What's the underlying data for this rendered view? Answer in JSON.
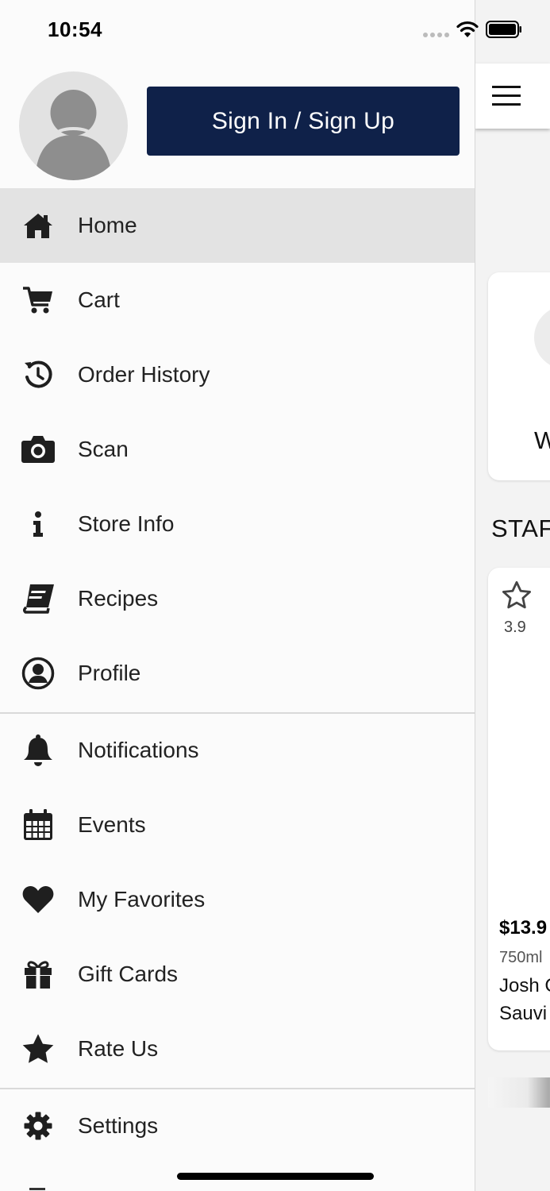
{
  "status_bar": {
    "time": "10:54"
  },
  "drawer": {
    "signin_label": "Sign In / Sign Up",
    "menu": [
      {
        "label": "Home",
        "icon": "home-icon",
        "active": true
      },
      {
        "label": "Cart",
        "icon": "cart-icon"
      },
      {
        "label": "Order History",
        "icon": "history-icon"
      },
      {
        "label": "Scan",
        "icon": "camera-icon"
      },
      {
        "label": "Store Info",
        "icon": "info-icon"
      },
      {
        "label": "Recipes",
        "icon": "book-icon"
      },
      {
        "label": "Profile",
        "icon": "user-circle-icon"
      },
      {
        "label": "Notifications",
        "icon": "bell-icon"
      },
      {
        "label": "Events",
        "icon": "calendar-icon"
      },
      {
        "label": "My Favorites",
        "icon": "heart-icon"
      },
      {
        "label": "Gift Cards",
        "icon": "gift-icon"
      },
      {
        "label": "Rate Us",
        "icon": "star-icon"
      },
      {
        "label": "Settings",
        "icon": "gear-icon"
      }
    ]
  },
  "background": {
    "card_letter": "W",
    "section_title": "STAF",
    "product": {
      "rating": "3.9",
      "price": "$13.9",
      "size": "750ml",
      "name_line1": "Josh C",
      "name_line2": "Sauvi"
    }
  },
  "colors": {
    "primary": "#0f2149",
    "active_row": "#e3e3e3"
  }
}
